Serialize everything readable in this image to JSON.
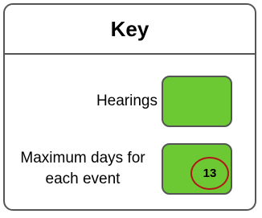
{
  "key": {
    "title": "Key",
    "items": [
      {
        "label": "Hearings",
        "color": "#6cc933"
      },
      {
        "label_line1": "Maximum days for",
        "label_line2": "each event",
        "color": "#6cc933",
        "badge": "13",
        "badge_color": "#b01818"
      }
    ]
  }
}
